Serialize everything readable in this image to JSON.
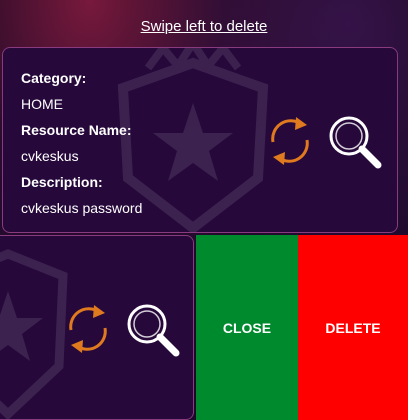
{
  "hint": {
    "swipe_text": "Swipe left to delete"
  },
  "item": {
    "category_label": "Category:",
    "category_value": "HOME",
    "resource_label": "Resource Name:",
    "resource_value": "cvkeskus",
    "description_label": "Description:",
    "description_value": "cvkeskus password"
  },
  "actions": {
    "close_label": "CLOSE",
    "delete_label": "DELETE",
    "close_color": "#008a2e",
    "delete_color": "#ff0000"
  },
  "icons": {
    "refresh": "refresh-icon",
    "search": "search-icon"
  },
  "colors": {
    "accent_orange": "#e07a1f",
    "card_border": "#8a3a7e",
    "card_bg": "#26083a"
  }
}
